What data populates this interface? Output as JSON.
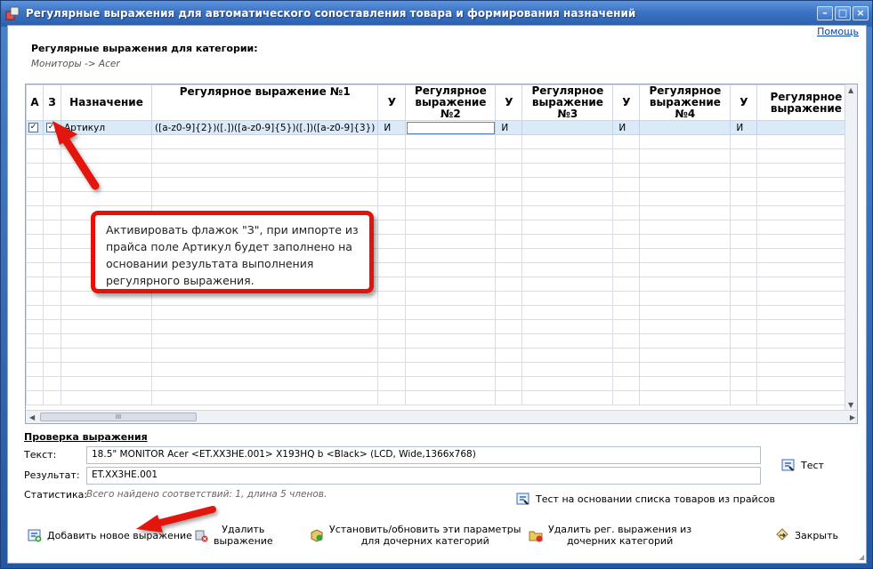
{
  "window": {
    "title": "Регулярные выражения для автоматического сопоставления товара и формирования назначений",
    "help": "Помощь"
  },
  "category": {
    "label": "Регулярные выражения для категории:",
    "path": "Мониторы -> Acer"
  },
  "grid": {
    "columns": [
      "А",
      "З",
      "Назначение",
      "Регулярное выражение №1",
      "У",
      "Регулярное выражение №2",
      "У",
      "Регулярное выражение №3",
      "У",
      "Регулярное выражение №4",
      "У",
      "Регулярное выражение"
    ],
    "row": {
      "a_checked": true,
      "z_checked": true,
      "target": "Артикул",
      "regex1": "([a-z0-9]{2})([.])([a-z0-9]{5})([.])([a-z0-9]{3})",
      "u1": "И",
      "regex2": "",
      "u2": "И",
      "regex3": "",
      "u3": "И",
      "regex4": "",
      "u4": "И",
      "regex5": ""
    },
    "hscroll_grip": "III"
  },
  "callout": "Активировать флажок \"З\", при импорте из прайса поле Артикул будет заполнено на основании результата выполнения регулярного выражения.",
  "check": {
    "title": "Проверка выражения",
    "text_label": "Текст:",
    "text_value": "18.5\" MONITOR Acer <ET.XX3HE.001> X193HQ b <Black> (LCD, Wide,1366x768)",
    "result_label": "Результат:",
    "result_value": "ET.XX3HE.001",
    "stats_label": "Статистика:",
    "stats_value": "Всего найдено соответствий: 1, длина 5 членов.",
    "test_label": "Тест",
    "test_list_label": "Тест на основании списка товаров из прайсов"
  },
  "buttons": {
    "add": "Добавить новое выражение",
    "delete_line1": "Удалить",
    "delete_line2": "выражение",
    "apply_line1": "Установить/обновить эти параметры",
    "apply_line2": "для дочерних категорий",
    "remove_line1": "Удалить рег. выражения из",
    "remove_line2": "дочерних категорий",
    "close": "Закрыть"
  },
  "colors": {
    "titlebar": "#3a72c2",
    "selection": "#dbeaf8",
    "callout_border": "#e3120b",
    "arrow": "#e3120b"
  }
}
